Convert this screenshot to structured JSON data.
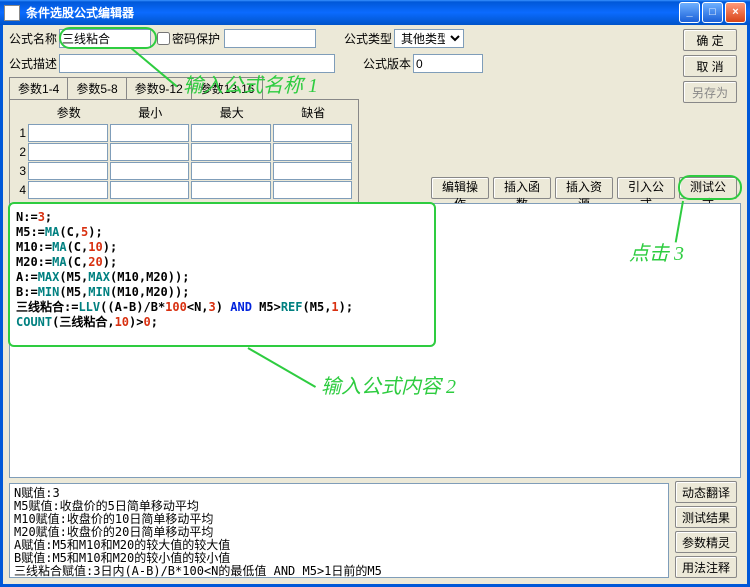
{
  "window": {
    "title": "条件选股公式编辑器"
  },
  "labels": {
    "name": "公式名称",
    "pwd": "密码保护",
    "type": "公式类型",
    "desc": "公式描述",
    "ver": "公式版本"
  },
  "fields": {
    "name": "三线粘合",
    "pwd": "",
    "type_selected": "其他类型",
    "desc": "",
    "ver": "0"
  },
  "buttons": {
    "ok": "确  定",
    "cancel": "取  消",
    "saveas": "另存为",
    "edit_op": "编辑操作",
    "insert_fn": "插入函数",
    "insert_res": "插入资源",
    "import_formula": "引入公式",
    "test_formula": "测试公式",
    "dyn_trans": "动态翻译",
    "test_result": "测试结果",
    "param_wizard": "参数精灵",
    "usage_note": "用法注释"
  },
  "tabs": {
    "t1": "参数1-4",
    "t2": "参数5-8",
    "t3": "参数9-12",
    "t4": "参数13-16"
  },
  "param_hdr": {
    "c1": "参数",
    "c2": "最小",
    "c3": "最大",
    "c4": "缺省"
  },
  "param_rows": [
    "1",
    "2",
    "3",
    "4"
  ],
  "code": {
    "l1": {
      "a": "N:=",
      "b": "3",
      "c": ";"
    },
    "l2": {
      "a": "M5:=",
      "b": "MA",
      "c": "(C,",
      "d": "5",
      "e": ");"
    },
    "l3": {
      "a": "M10:=",
      "b": "MA",
      "c": "(C,",
      "d": "10",
      "e": ");"
    },
    "l4": {
      "a": "M20:=",
      "b": "MA",
      "c": "(C,",
      "d": "20",
      "e": ");"
    },
    "l5": {
      "a": "A:=",
      "b": "MAX",
      "c": "(M5,",
      "d": "MAX",
      "e": "(M10,M20));"
    },
    "l6": {
      "a": "B:=",
      "b": "MIN",
      "c": "(M5,",
      "d": "MIN",
      "e": "(M10,M20));"
    },
    "l7": {
      "a": "三线粘合:=",
      "b": "LLV",
      "c": "((A-B)/B*",
      "d": "100",
      "e": "<N,",
      "f": "3",
      "g": ")",
      "h": " AND ",
      "i": "M5>",
      "j": "REF",
      "k": "(M5,",
      "l": "1",
      "m": ");"
    },
    "l8": {
      "a": "COUNT",
      "b": "(三线粘合,",
      "c": "10",
      "d": ")>",
      "e": "0",
      "f": ";"
    }
  },
  "output": {
    "l1": "N赋值:3",
    "l2": "M5赋值:收盘价的5日简单移动平均",
    "l3": "M10赋值:收盘价的10日简单移动平均",
    "l4": "M20赋值:收盘价的20日简单移动平均",
    "l5": "A赋值:M5和M10和M20的较大值的较大值",
    "l6": "B赋值:M5和M10和M20的较小值的较小值",
    "l7": "三线粘合赋值:3日内(A-B)/B*100<N的最低值 AND M5>1日前的M5"
  },
  "annotations": {
    "a1": "输入公式名称  1",
    "a2": "输入公式内容  2",
    "a3": "点击  3"
  }
}
